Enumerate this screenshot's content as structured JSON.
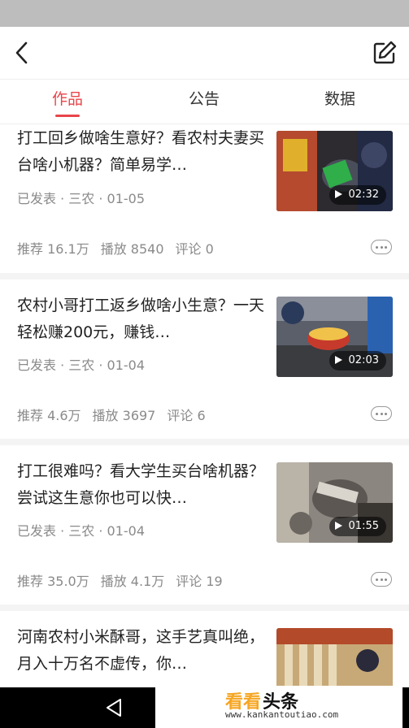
{
  "header": {
    "back_icon": "chevron-left-icon",
    "edit_icon": "edit-square-icon"
  },
  "tabs": [
    {
      "label": "作品",
      "active": true
    },
    {
      "label": "公告",
      "active": false
    },
    {
      "label": "数据",
      "active": false
    }
  ],
  "colors": {
    "accent": "#e8454a",
    "meta_text": "#8a8a8a",
    "status_bar": "#bdbdbd"
  },
  "articles": [
    {
      "title": "打工回乡做啥生意好？看农村夫妻买台啥小机器？简单易学…",
      "meta": "已发表 · 三农 · 01-05",
      "recommend": "推荐 16.1万",
      "plays": "播放 8540",
      "comments": "评论 0",
      "duration": "02:32"
    },
    {
      "title": "农村小哥打工返乡做啥小生意？一天轻松赚200元，赚钱…",
      "meta": "已发表 · 三农 · 01-04",
      "recommend": "推荐 4.6万",
      "plays": "播放 3697",
      "comments": "评论 6",
      "duration": "02:03"
    },
    {
      "title": "打工很难吗？看大学生买台啥机器？尝试这生意你也可以快…",
      "meta": "已发表 · 三农 · 01-04",
      "recommend": "推荐 35.0万",
      "plays": "播放 4.1万",
      "comments": "评论 19",
      "duration": "01:55"
    },
    {
      "title": "河南农村小米酥哥，这手艺真叫绝，月入十万名不虚传，你…"
    }
  ],
  "watermark": {
    "brand_a": "看看",
    "brand_b": "头条",
    "url": "www.kankantoutiao.com"
  }
}
